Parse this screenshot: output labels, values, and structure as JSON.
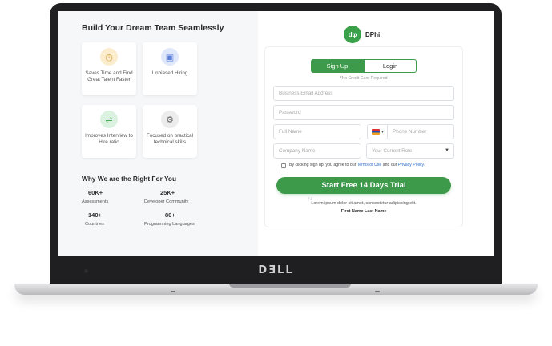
{
  "left": {
    "title": "Build Your Dream Team Seamlessly",
    "cards": [
      {
        "icon": "clock-icon",
        "glyph": "◷",
        "bg": "#fbeccd",
        "color": "#d6a23a",
        "text": "Saves Time and Find Great Talent Faster"
      },
      {
        "icon": "document-check-icon",
        "glyph": "▣",
        "bg": "#dfe8fb",
        "color": "#5b7fd8",
        "text": "Unbiased Hiring"
      },
      {
        "icon": "handshake-icon",
        "glyph": "⇌",
        "bg": "#dcf2e0",
        "color": "#3aa04a",
        "text": "Improves Interview to Hire ratio"
      },
      {
        "icon": "settings-document-icon",
        "glyph": "⚙",
        "bg": "#ececec",
        "color": "#666666",
        "text": "Focused on practical technical skills"
      }
    ],
    "why_title": "Why We are the Right For You",
    "stats": [
      {
        "value": "60K+",
        "label": "Assessments"
      },
      {
        "value": "25K+",
        "label": "Developer Community"
      },
      {
        "value": "140+",
        "label": "Countries"
      },
      {
        "value": "80+",
        "label": "Programming Languages"
      }
    ]
  },
  "brand": {
    "logo_text": "dφ",
    "name": "DPhi",
    "laptop_brand": "DƎLL"
  },
  "tabs": {
    "signup": "Sign Up",
    "login": "Login"
  },
  "note": "*No Credit Card Required",
  "form": {
    "email_placeholder": "Business Email Address",
    "password_placeholder": "Password",
    "fullname_placeholder": "Full Name",
    "phone_placeholder": "Phone Number",
    "company_placeholder": "Company Name",
    "role_placeholder": "Your Current Role",
    "agree_prefix": "By clicking sign up, you agree to our",
    "terms_link": "Terms of Use",
    "agree_mid": "and our",
    "privacy_link": "Privacy Policy.",
    "cta": "Start Free 14 Days Trial"
  },
  "testimonial": {
    "quote": "Lorem ipsum dolor sit amet, consectetur adipiscing elit.",
    "author": "First Name Last Name"
  },
  "colors": {
    "accent": "#3d9a4a",
    "link": "#2d6fd0"
  }
}
